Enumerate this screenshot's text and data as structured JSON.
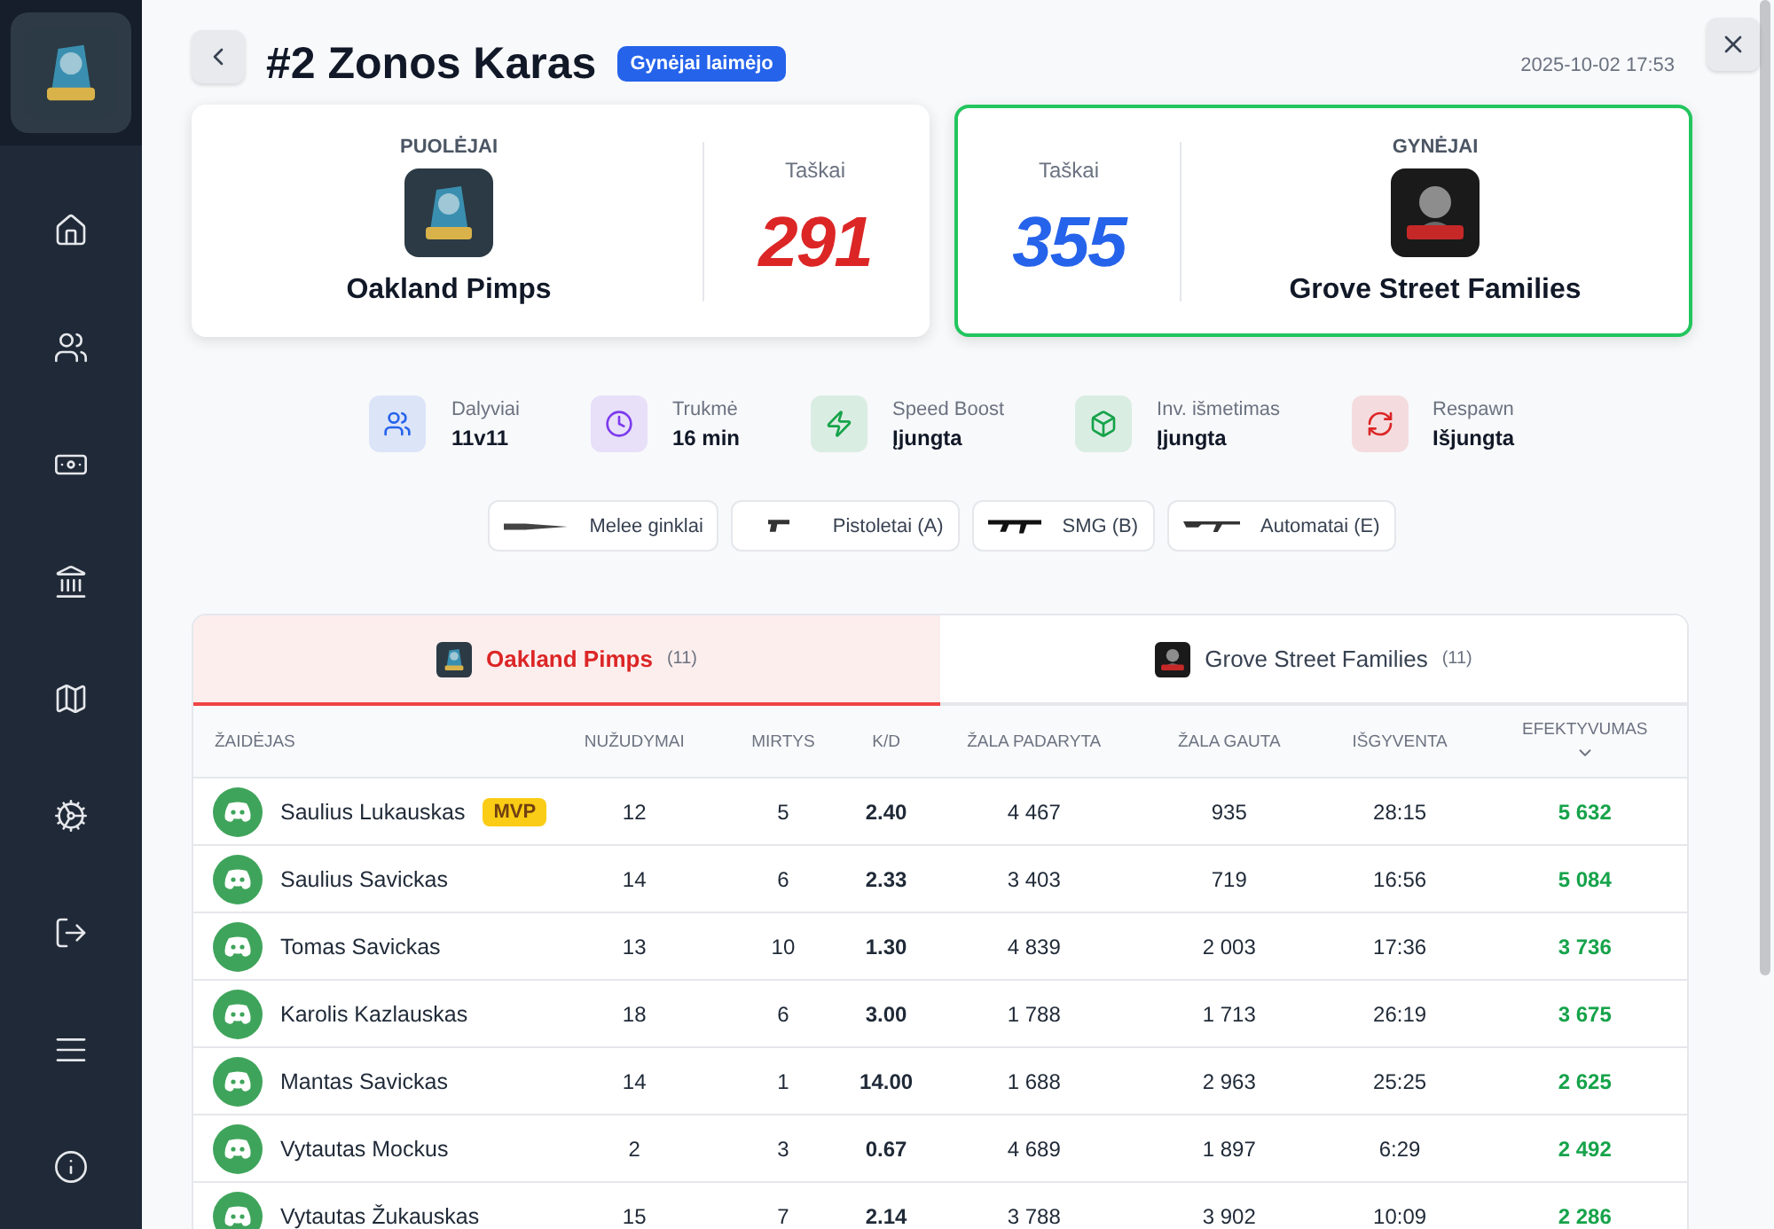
{
  "sidebar": {
    "items": [
      {
        "kind": "home"
      },
      {
        "kind": "users"
      },
      {
        "kind": "money"
      },
      {
        "kind": "bank"
      },
      {
        "kind": "map"
      },
      {
        "kind": "gear"
      },
      {
        "kind": "logout"
      },
      {
        "kind": "menu"
      },
      {
        "kind": "info"
      }
    ]
  },
  "header": {
    "title": "#2 Zonos Karas",
    "badge": "Gynėjai laimėjo",
    "date": "2025-10-02 17:53"
  },
  "teams": [
    {
      "role": "PUOLĖJAI",
      "name": "Oakland Pimps",
      "score_label": "Taškai",
      "score": "291",
      "color": "#dc2626",
      "winner": false,
      "logo": {
        "kind": "kings"
      }
    },
    {
      "role": "GYNĖJAI",
      "name": "Grove Street Families",
      "score_label": "Taškai",
      "score": "355",
      "color": "#2563eb",
      "winner": true,
      "logo": {
        "kind": "command"
      }
    }
  ],
  "stats": [
    {
      "kind": "users",
      "label": "Dalyviai",
      "value": "11v11",
      "color": "#2563eb"
    },
    {
      "kind": "clock",
      "label": "Trukmė",
      "value": "16 min",
      "color": "#7c3aed"
    },
    {
      "kind": "bolt",
      "label": "Speed Boost",
      "value": "Įjungta",
      "color": "#16a34a"
    },
    {
      "kind": "box",
      "label": "Inv. išmetimas",
      "value": "Įjungta",
      "color": "#16a34a"
    },
    {
      "kind": "refresh",
      "label": "Respawn",
      "value": "Išjungta",
      "color": "#dc2626"
    }
  ],
  "weapons": [
    {
      "kind": "knife",
      "label": "Melee ginklai"
    },
    {
      "kind": "pistol",
      "label": "Pistoletai (A)"
    },
    {
      "kind": "smg",
      "label": "SMG (B)"
    },
    {
      "kind": "rifle",
      "label": "Automatai (E)"
    }
  ],
  "tabs": [
    {
      "name": "Oakland Pimps",
      "count": "(11)",
      "selected": true,
      "logo": {
        "kind": "kings"
      }
    },
    {
      "name": "Grove Street Families",
      "count": "(11)",
      "selected": false,
      "logo": {
        "kind": "command"
      }
    }
  ],
  "table": {
    "columns": [
      "ŽAIDĖJAS",
      "NUŽUDYMAI",
      "MIRTYS",
      "K/D",
      "ŽALA PADARYTA",
      "ŽALA GAUTA",
      "IŠGYVENTA",
      "EFEKTYVUMAS"
    ],
    "rows": [
      {
        "badge": "MVP",
        "cells": [
          "Saulius Lukauskas",
          "12",
          "5",
          "2.40",
          "4 467",
          "935",
          "28:15",
          "5 632"
        ]
      },
      {
        "cells": [
          "Saulius Savickas",
          "14",
          "6",
          "2.33",
          "3 403",
          "719",
          "16:56",
          "5 084"
        ]
      },
      {
        "cells": [
          "Tomas Savickas",
          "13",
          "10",
          "1.30",
          "4 839",
          "2 003",
          "17:36",
          "3 736"
        ]
      },
      {
        "cells": [
          "Karolis Kazlauskas",
          "18",
          "6",
          "3.00",
          "1 788",
          "1 713",
          "26:19",
          "3 675"
        ]
      },
      {
        "cells": [
          "Mantas Savickas",
          "14",
          "1",
          "14.00",
          "1 688",
          "2 963",
          "25:25",
          "2 625"
        ]
      },
      {
        "cells": [
          "Vytautas Mockus",
          "2",
          "3",
          "0.67",
          "4 689",
          "1 897",
          "6:29",
          "2 492"
        ]
      },
      {
        "cells": [
          "Vytautas Žukauskas",
          "15",
          "7",
          "2.14",
          "3 788",
          "3 902",
          "10:09",
          "2 286"
        ]
      }
    ]
  }
}
